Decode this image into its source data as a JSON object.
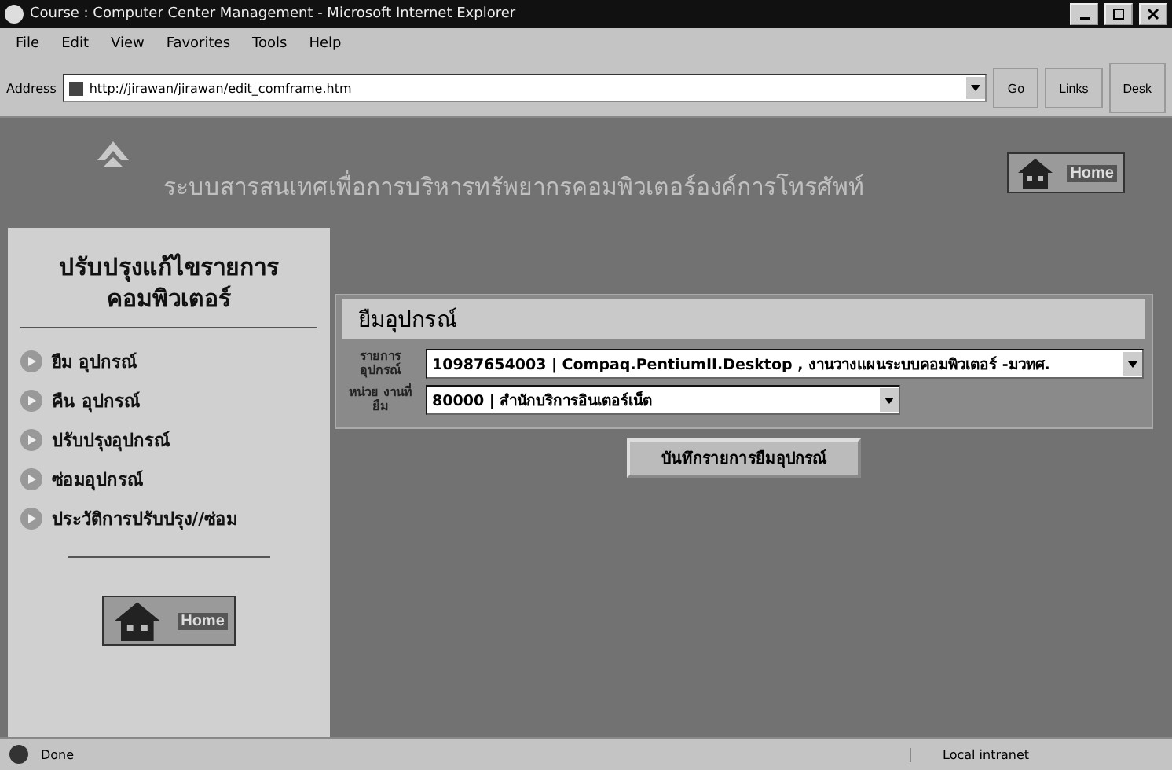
{
  "window": {
    "title": "Course : Computer Center Management - Microsoft Internet Explorer"
  },
  "menu": [
    "File",
    "Edit",
    "View",
    "Favorites",
    "Tools",
    "Help"
  ],
  "address": {
    "label": "Address",
    "url": "http://jirawan/jirawan/edit_comframe.htm",
    "go": "Go",
    "links": "Links",
    "desk": "Desk"
  },
  "header": {
    "title": "ระบบสารสนเทศเพื่อการบริหารทรัพยากรคอมพิวเตอร์องค์การโทรศัพท์",
    "home": "Home"
  },
  "sidebar": {
    "title": "ปรับปรุงแก้ไขรายการ คอมพิวเตอร์",
    "items": [
      {
        "label": "ยืม อุปกรณ์"
      },
      {
        "label": "คืน อุปกรณ์"
      },
      {
        "label": "ปรับปรุงอุปกรณ์"
      },
      {
        "label": "ซ่อมอุปกรณ์"
      },
      {
        "label": "ประวัติการปรับปรุง//ซ่อม"
      }
    ],
    "home": "Home"
  },
  "form": {
    "title": "ยืมอุปกรณ์",
    "fields": [
      {
        "label": "รายการ อุปกรณ์",
        "value": "10987654003 | Compaq.PentiumII.Desktop , งานวางแผนระบบคอมพิวเตอร์ -มวทศ.",
        "wide": true
      },
      {
        "label": "หน่วย งานที่ยืม",
        "value": "80000 | สำนักบริการอินเตอร์เน็ต",
        "wide": false
      }
    ],
    "button": "บันทึกรายการยืมอุปกรณ์"
  },
  "status_bar": {
    "text": "Done",
    "zone": "Local intranet"
  }
}
